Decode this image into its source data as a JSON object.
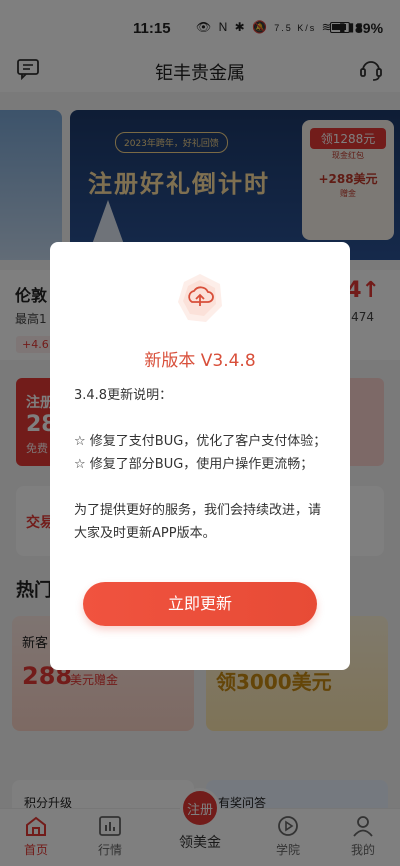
{
  "status": {
    "time": "11:15",
    "network": "7.5 K/s",
    "battery": "89%"
  },
  "app": {
    "title": "钜丰贵金属"
  },
  "banner": {
    "pill": "2023年跨年，好礼回馈",
    "headline": "注册好礼倒计时",
    "card_line1": "领1288元",
    "card_line2": "现金红包",
    "card_line3": "+288美元",
    "card_line4": "赠金"
  },
  "quote": {
    "name": "伦敦",
    "high": "最高1",
    "change": "+4.6",
    "price": "4↑",
    "sub": "474"
  },
  "promo": {
    "l1": "注册",
    "l2": "28",
    "l3": "免费"
  },
  "trade": {
    "label": "交易"
  },
  "hot": {
    "title": "热门"
  },
  "cards": {
    "left_title": "新客",
    "left_value": "288",
    "left_unit": "美元赠金",
    "right_value": "领3000美元"
  },
  "lower": {
    "left": "积分升级",
    "right": "有奖问答"
  },
  "tabs": [
    {
      "label": "首页",
      "icon": "home-icon"
    },
    {
      "label": "行情",
      "icon": "chart-icon"
    },
    {
      "label": "领美金",
      "badge": "注册",
      "icon": "register-icon"
    },
    {
      "label": "学院",
      "icon": "play-icon"
    },
    {
      "label": "我的",
      "icon": "profile-icon"
    }
  ],
  "modal": {
    "title": "新版本 V3.4.8",
    "desc_heading": "3.4.8更新说明：",
    "item1": "☆ 修复了支付BUG，优化了客户支付体验；",
    "item2": "☆ 修复了部分BUG，使用户操作更流畅；",
    "outro": "为了提供更好的服务，我们会持续改进，请大家及时更新APP版本。",
    "button": "立即更新"
  },
  "colors": {
    "accent": "#e53935",
    "modal_title": "#d84f3a"
  }
}
